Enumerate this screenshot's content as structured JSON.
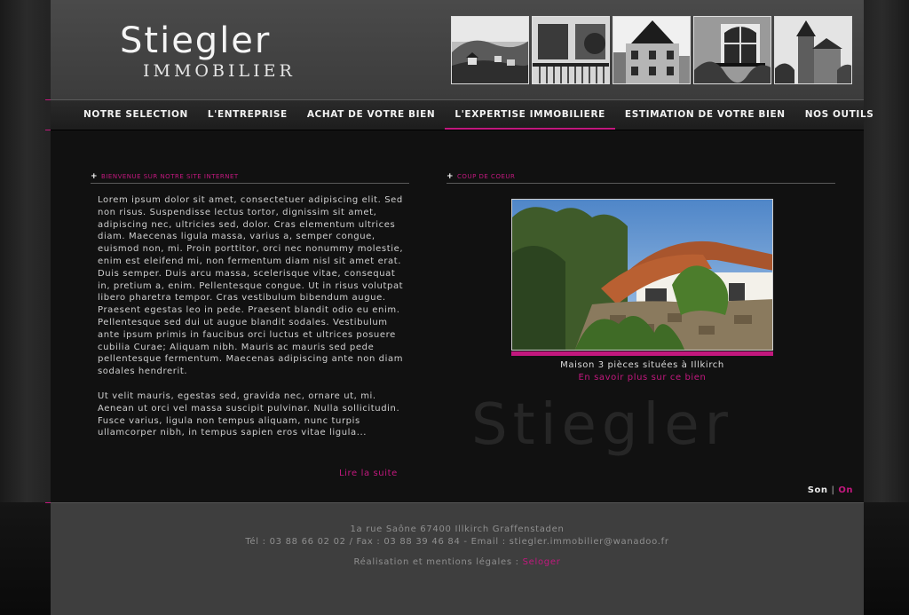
{
  "brand": {
    "name": "Stiegler",
    "subtitle": "IMMOBILIER"
  },
  "thumbnails": [
    {
      "icon": "village-photo"
    },
    {
      "icon": "balcony-photo"
    },
    {
      "icon": "half-timbered-house-photo"
    },
    {
      "icon": "window-balcony-photo"
    },
    {
      "icon": "castle-photo"
    }
  ],
  "nav": {
    "items": [
      {
        "label": "NOTRE SELECTION"
      },
      {
        "label": "L'ENTREPRISE"
      },
      {
        "label": "ACHAT DE VOTRE BIEN"
      },
      {
        "label": "L'EXPERTISE IMMOBILIERE"
      },
      {
        "label": "ESTIMATION DE VOTRE BIEN"
      },
      {
        "label": "NOS OUTILS"
      }
    ],
    "active_index": 3
  },
  "welcome": {
    "heading": "Bienvenue sur notre site internet",
    "paragraph1": "Lorem ipsum dolor sit amet, consectetuer adipiscing elit. Sed non risus. Suspendisse lectus tortor, dignissim sit amet, adipiscing nec, ultricies sed, dolor. Cras elementum ultrices diam. Maecenas ligula massa, varius a, semper congue, euismod non, mi. Proin porttitor, orci nec nonummy molestie, enim est eleifend mi, non fermentum diam nisl sit amet erat. Duis semper. Duis arcu massa, scelerisque vitae, consequat in, pretium a, enim. Pellentesque congue. Ut in risus volutpat libero pharetra tempor. Cras vestibulum bibendum augue. Praesent egestas leo in pede. Praesent blandit odio eu enim. Pellentesque sed dui ut augue blandit sodales. Vestibulum ante ipsum primis in faucibus orci luctus et ultrices posuere cubilia Curae; Aliquam nibh. Mauris ac mauris sed pede pellentesque fermentum. Maecenas adipiscing ante non diam sodales hendrerit.",
    "paragraph2": "Ut velit mauris, egestas sed, gravida nec, ornare ut, mi. Aenean ut orci vel massa suscipit pulvinar. Nulla sollicitudin. Fusce varius, ligula non tempus aliquam, nunc turpis ullamcorper nibh, in tempus sapien eros vitae ligula...",
    "read_more": "Lire la suite"
  },
  "featured": {
    "heading": "Coup de coeur",
    "caption": "Maison 3 pièces situées à Illkirch",
    "link": "En savoir plus sur ce bien"
  },
  "watermark": "Stiegler",
  "sound": {
    "label": "Son",
    "separator": "|",
    "state": "On"
  },
  "footer": {
    "address": "1a rue Saône 67400 Illkirch Graffenstaden",
    "contact": "Tél : 03 88 66 02 02 / Fax : 03 88 39 46 84 - Email : stiegler.immobilier@wanadoo.fr",
    "credit_label": "Réalisation et mentions légales :",
    "credit_link": "Seloger"
  },
  "colors": {
    "accent": "#c2187e",
    "background": "#111111",
    "header": "#444444",
    "footer": "#3e3e3e"
  }
}
